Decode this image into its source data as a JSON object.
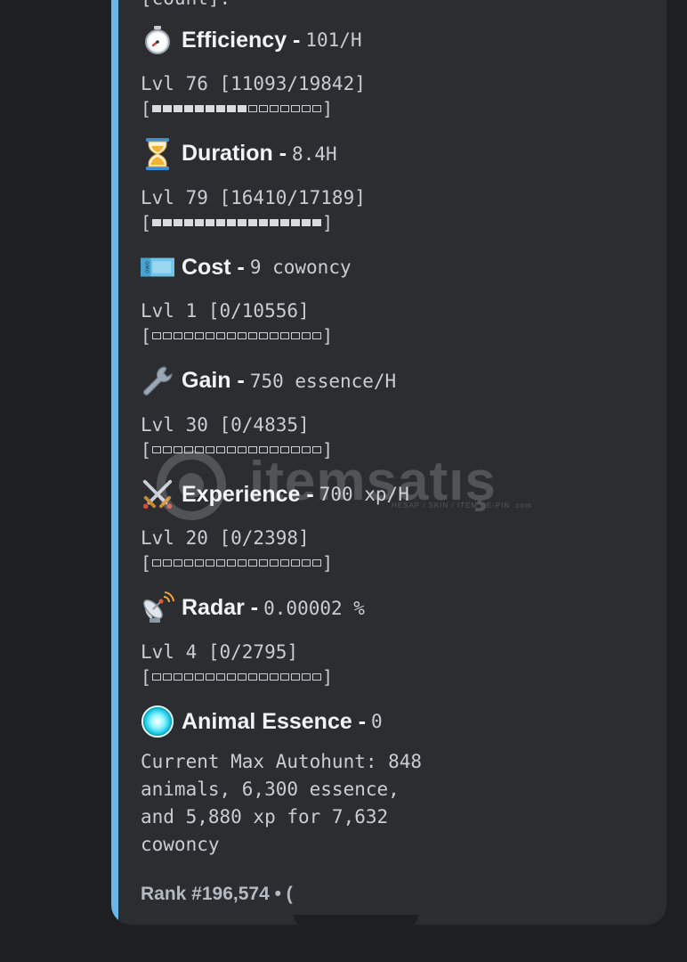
{
  "top_cut_text": "[count].",
  "fields": [
    {
      "icon": "stopwatch-icon",
      "name": "Efficiency -",
      "value": "101/H",
      "level": "Lvl 76 [11093/19842]",
      "progress_fraction": 0.56,
      "progress_filled": 9,
      "progress_total": 16
    },
    {
      "icon": "hourglass-icon",
      "name": "Duration -",
      "value": "8.4H",
      "level": "Lvl 79 [16410/17189]",
      "progress_fraction": 0.95,
      "progress_filled": 16,
      "progress_total": 16
    },
    {
      "icon": "cowoncy-ticket-icon",
      "name": "Cost -",
      "value": "9 cowoncy",
      "level": "Lvl 1 [0/10556]",
      "progress_fraction": 0,
      "progress_filled": 0,
      "progress_total": 16
    },
    {
      "icon": "wrench-icon",
      "name": "Gain -",
      "value": "750 essence/H",
      "level": "Lvl 30 [0/4835]",
      "progress_fraction": 0,
      "progress_filled": 0,
      "progress_total": 16
    },
    {
      "icon": "crossed-swords-icon",
      "name": "Experience -",
      "value": "700 xp/H",
      "level": "Lvl 20 [0/2398]",
      "progress_fraction": 0,
      "progress_filled": 0,
      "progress_total": 16
    },
    {
      "icon": "satellite-dish-icon",
      "name": "Radar -",
      "value": "0.00002 %",
      "level": "Lvl 4 [0/2795]",
      "progress_fraction": 0,
      "progress_filled": 0,
      "progress_total": 16
    }
  ],
  "essence": {
    "icon": "glowing-orb-icon",
    "name": "Animal Essence -",
    "value": "0",
    "description_lines": [
      "Current Max Autohunt: 848",
      "animals, 6,300 essence,",
      "and 5,880 xp for 7,632",
      "cowoncy"
    ]
  },
  "footer": {
    "rank_text": "Rank #196,574 • ("
  },
  "watermark": {
    "text": "itemsatış",
    "sub": "HESAP / SKIN / ITEM / E-PIN   .com"
  },
  "colors": {
    "background": "#1e1f22",
    "embed": "#2b2d31",
    "embed_bar": "#6ab4e8",
    "title": "#f2f3f5",
    "mono_text": "#c9ccd1",
    "muted": "#b5bac1"
  }
}
